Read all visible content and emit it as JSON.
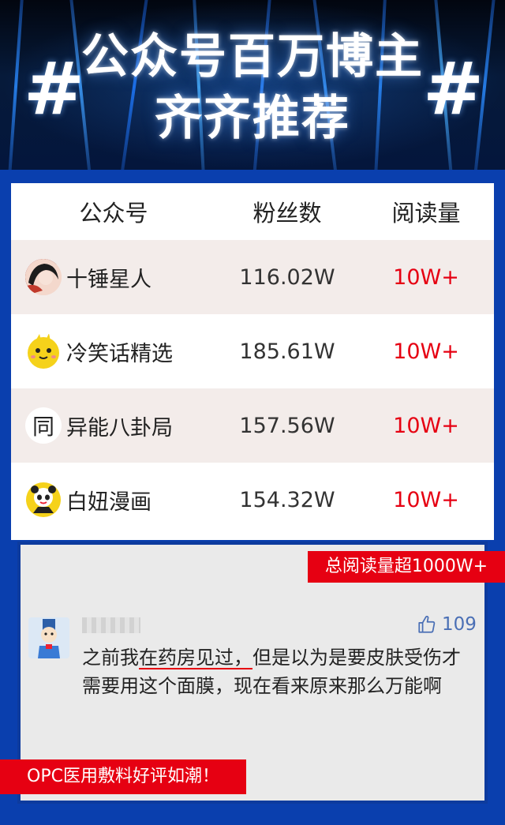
{
  "header": {
    "hash_symbol": "#",
    "title_line1": "公众号百万博主",
    "title_line2": "齐齐推荐"
  },
  "table": {
    "columns": [
      "公众号",
      "粉丝数",
      "阅读量"
    ],
    "rows": [
      {
        "avatar": "portrait-avatar-icon",
        "name": "十锤星人",
        "fans": "116.02W",
        "reads": "10W+"
      },
      {
        "avatar": "yellow-chick-avatar-icon",
        "name": "冷笑话精选",
        "fans": "185.61W",
        "reads": "10W+"
      },
      {
        "avatar": "glyph-avatar-icon",
        "avatar_text": "同",
        "name": "异能八卦局",
        "fans": "157.56W",
        "reads": "10W+"
      },
      {
        "avatar": "panda-girl-avatar-icon",
        "name": "白妞漫画",
        "fans": "154.32W",
        "reads": "10W+"
      }
    ]
  },
  "comment": {
    "total_badge": "总阅读量超1000W+",
    "likes": "109",
    "text_prefix": "之前我",
    "text_underlined": "在药房见过，",
    "text_rest": "但是以为是要皮肤受伤才需要用这个面膜，现在看来原来那么万能啊",
    "bottom_badge": "OPC医用敷料好评如潮！"
  },
  "colors": {
    "accent_red": "#e60012",
    "frame_blue": "#0a3fae",
    "like_blue": "#4a6fb5"
  }
}
